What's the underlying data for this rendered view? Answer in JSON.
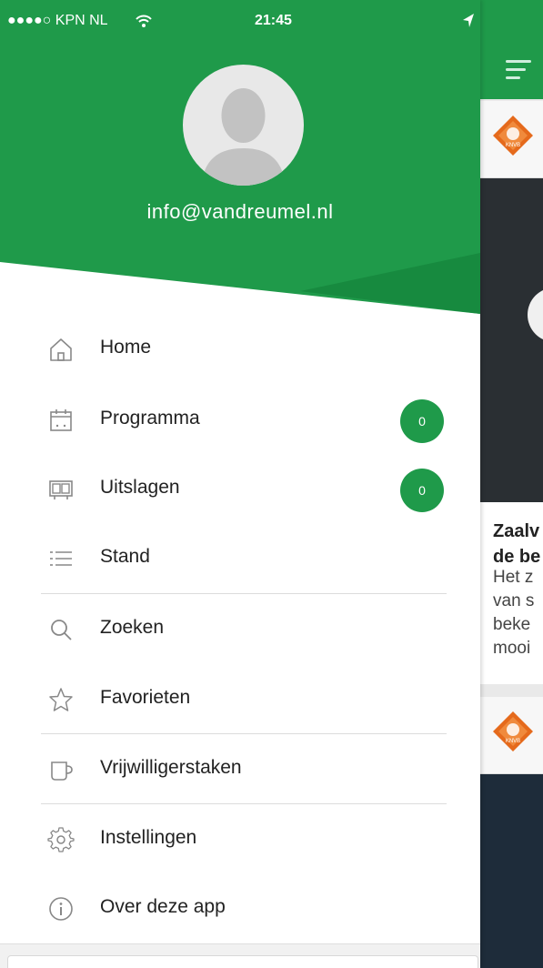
{
  "status_bar": {
    "carrier": "●●●●○ KPN NL",
    "time": "21:45"
  },
  "profile": {
    "email": "info@vandreumel.nl"
  },
  "menu": {
    "items": [
      {
        "label": "Home",
        "icon": "home-icon"
      },
      {
        "label": "Programma",
        "icon": "calendar-icon",
        "badge": "0"
      },
      {
        "label": "Uitslagen",
        "icon": "scoreboard-icon",
        "badge": "0"
      },
      {
        "label": "Stand",
        "icon": "list-icon"
      },
      {
        "label": "Zoeken",
        "icon": "search-icon"
      },
      {
        "label": "Favorieten",
        "icon": "star-icon"
      },
      {
        "label": "Vrijwilligerstaken",
        "icon": "cup-icon"
      },
      {
        "label": "Instellingen",
        "icon": "gear-icon"
      },
      {
        "label": "Over deze app",
        "icon": "info-icon"
      }
    ]
  },
  "background_feed": {
    "card1_title_lines": [
      "Zaalv",
      "de be"
    ],
    "card1_text_lines": [
      "Het z",
      "van s",
      "beke",
      "mooi"
    ]
  },
  "colors": {
    "brand_green": "#1f9a4a",
    "brand_green_dark": "#178a3f",
    "knvb_orange": "#e56a1c"
  }
}
